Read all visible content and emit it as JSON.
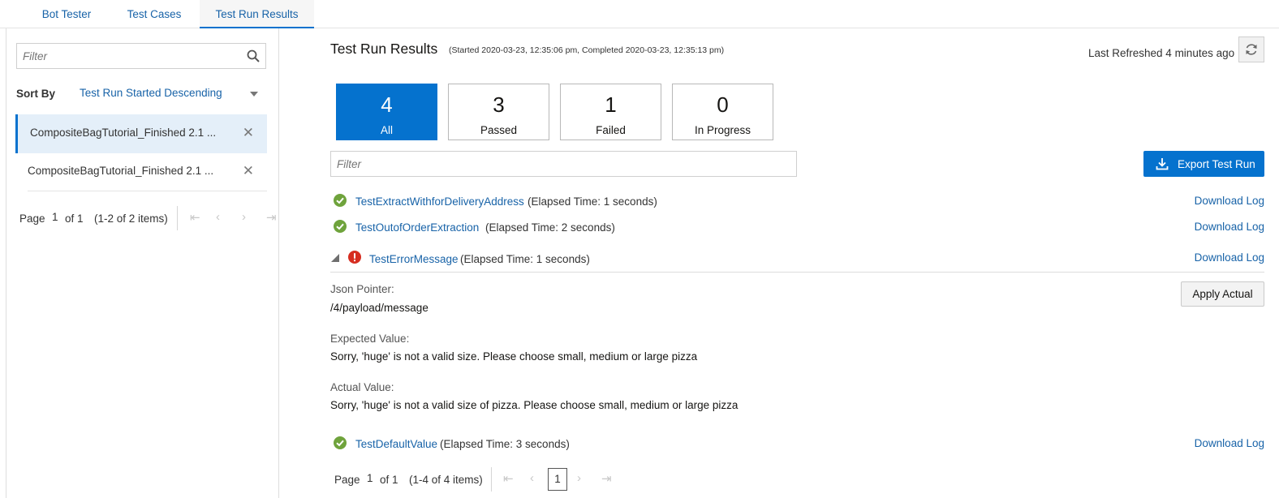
{
  "tabs": [
    "Bot Tester",
    "Test Cases",
    "Test Run Results"
  ],
  "left": {
    "filter_placeholder": "Filter",
    "sort_label": "Sort By",
    "sort_value": "Test Run Started Descending",
    "runs": [
      "CompositeBagTutorial_Finished 2.1 ...",
      "CompositeBagTutorial_Finished 2.1 ..."
    ],
    "pager": {
      "page_label": "Page",
      "page": "1",
      "of": "of 1",
      "items": "(1-2 of 2 items)"
    }
  },
  "main": {
    "title": "Test Run Results",
    "subtitle": "(Started 2020-03-23, 12:35:06 pm, Completed 2020-03-23, 12:35:13 pm)",
    "last_refreshed": "Last Refreshed 4 minutes ago",
    "cards": [
      {
        "value": "4",
        "label": "All"
      },
      {
        "value": "3",
        "label": "Passed"
      },
      {
        "value": "1",
        "label": "Failed"
      },
      {
        "value": "0",
        "label": "In Progress"
      }
    ],
    "filter_placeholder": "Filter",
    "export_label": "Export Test Run",
    "download_label": "Download Log",
    "tests": [
      {
        "name": "TestExtractWithforDeliveryAddress",
        "elapsed": "(Elapsed Time: 1 seconds)",
        "status": "passed"
      },
      {
        "name": "TestOutofOrderExtraction",
        "elapsed": "(Elapsed Time: 2 seconds)",
        "status": "passed"
      },
      {
        "name": "TestErrorMessage",
        "elapsed": "(Elapsed Time: 1 seconds)",
        "status": "failed"
      },
      {
        "name": "TestDefaultValue",
        "elapsed": "(Elapsed Time: 3 seconds)",
        "status": "passed"
      }
    ],
    "detail": {
      "json_pointer_label": "Json Pointer:",
      "json_pointer_value": "/4/payload/message",
      "expected_label": "Expected Value:",
      "expected_value": "Sorry, 'huge' is not a valid size. Please choose small, medium or large pizza",
      "actual_label": "Actual Value:",
      "actual_value": "Sorry, 'huge' is not a valid size of pizza. Please choose small, medium or large pizza",
      "apply_label": "Apply Actual"
    },
    "pager": {
      "page_label": "Page",
      "page": "1",
      "of": "of 1",
      "items": "(1-4 of 4 items)",
      "current": "1"
    }
  },
  "colors": {
    "accent": "#0572ce",
    "link": "#1863a8",
    "passed": "#6fa33c",
    "failed": "#d62d20"
  },
  "icons": [
    "search-icon",
    "chevron-down-icon",
    "close-icon",
    "refresh-icon",
    "download-icon",
    "check-circle-icon",
    "error-circle-icon",
    "first-page-icon",
    "prev-page-icon",
    "next-page-icon",
    "last-page-icon"
  ]
}
